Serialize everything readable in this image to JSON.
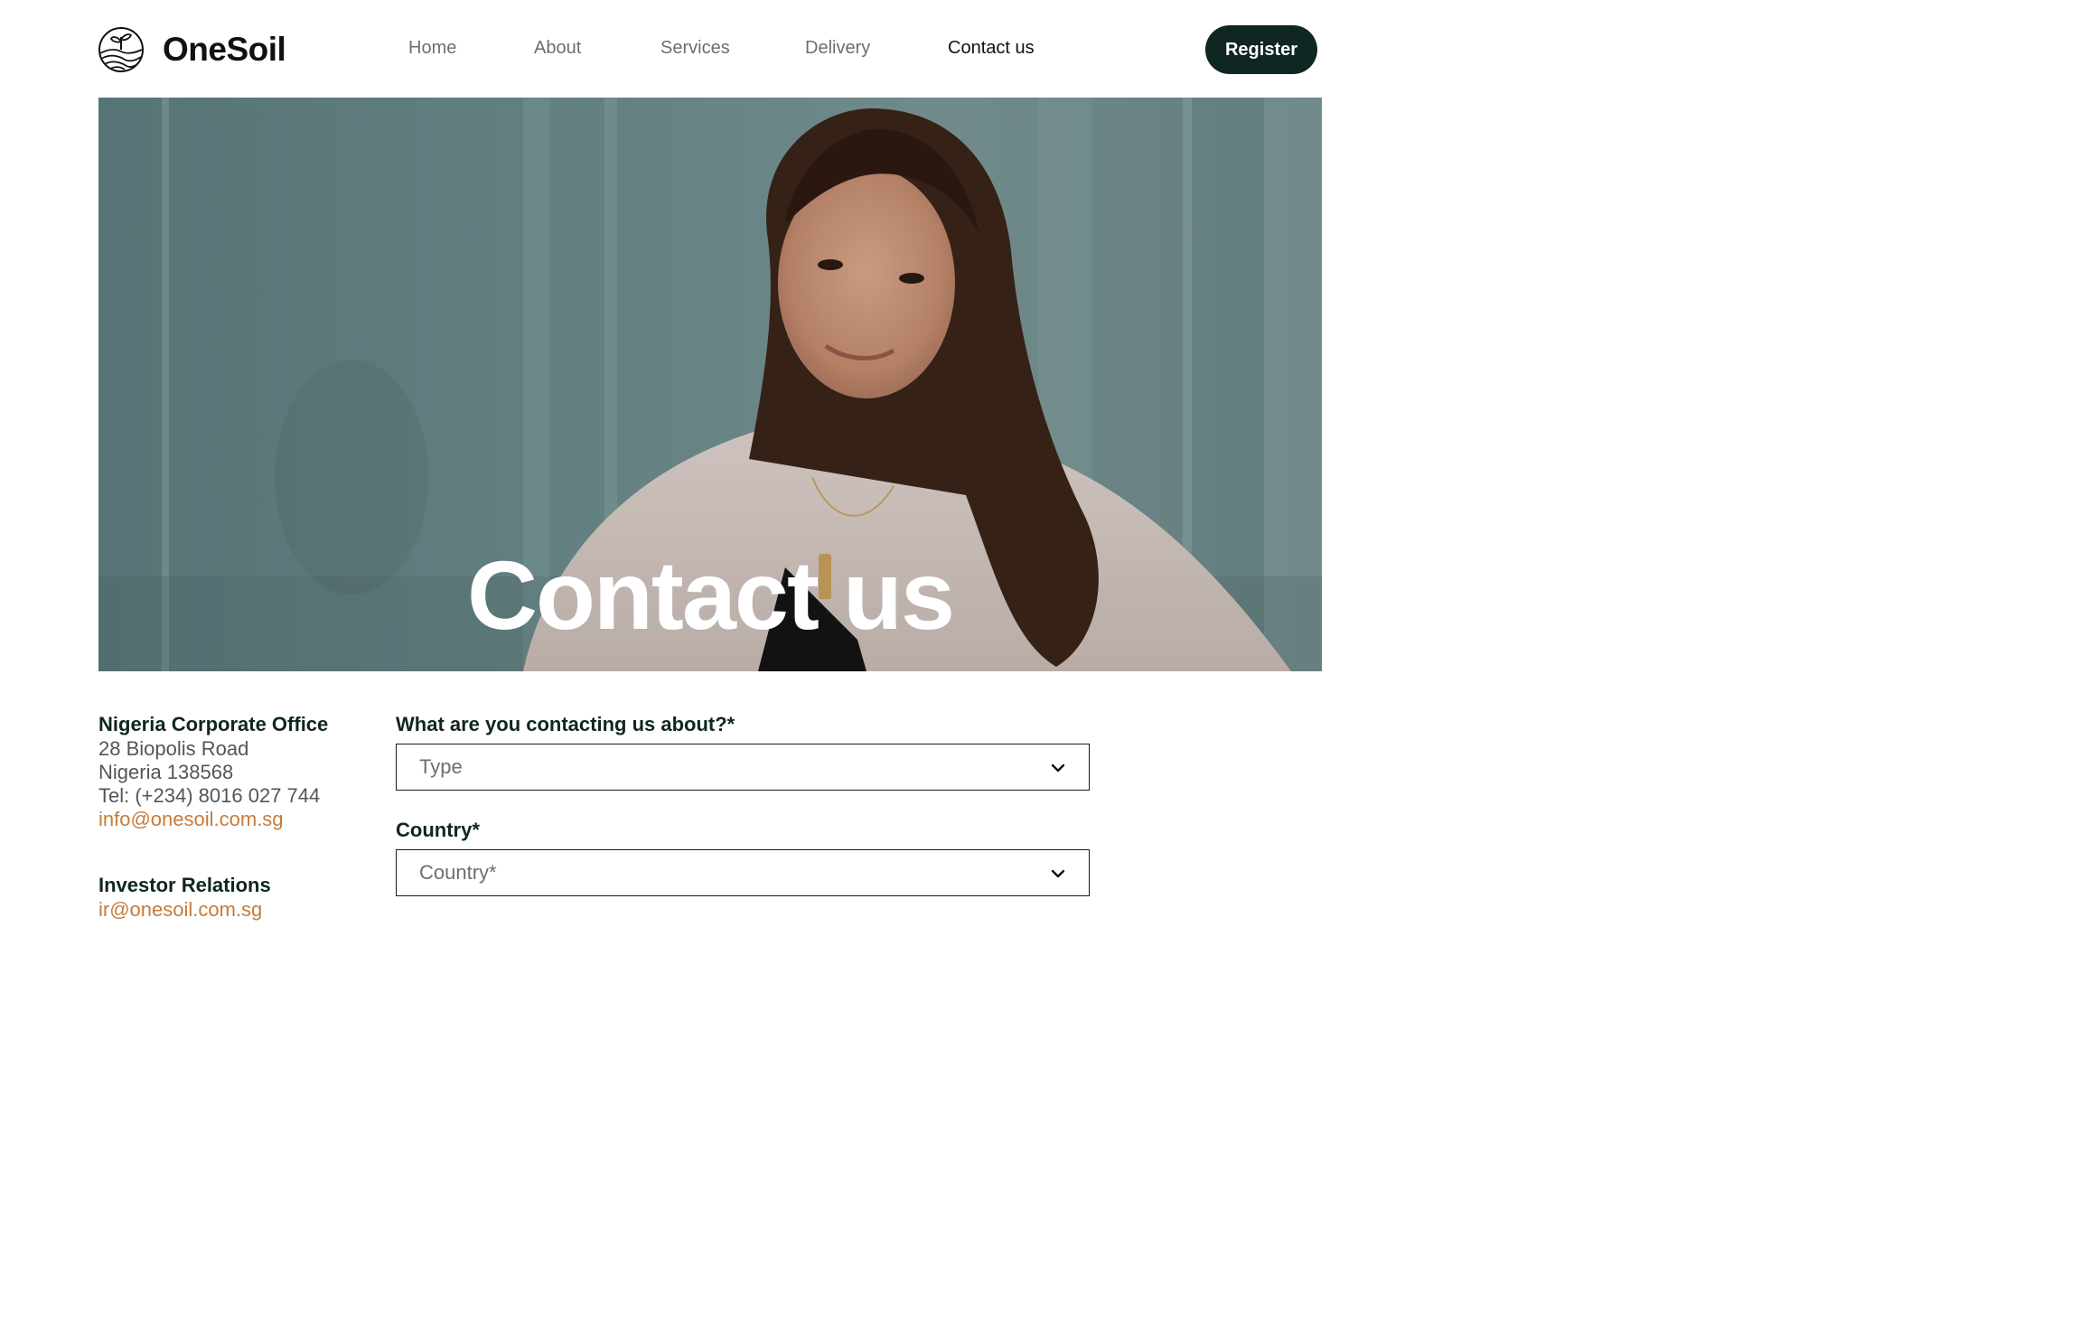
{
  "brand": {
    "name": "OneSoil",
    "logo_icon": "sprout-over-fields-icon"
  },
  "nav": {
    "items": [
      {
        "label": "Home",
        "active": false
      },
      {
        "label": "About",
        "active": false
      },
      {
        "label": "Services",
        "active": false
      },
      {
        "label": "Delivery",
        "active": false
      },
      {
        "label": "Contact us",
        "active": true
      }
    ],
    "register_label": "Register"
  },
  "hero": {
    "title": "Contact us"
  },
  "office": {
    "title": "Nigeria Corporate Office",
    "address_line1": "28 Biopolis Road",
    "address_line2": "Nigeria 138568",
    "phone": "Tel: (+234) 8016 027 744",
    "email": "info@onesoil.com.sg"
  },
  "investor": {
    "title": "Investor Relations",
    "email": "ir@onesoil.com.sg"
  },
  "form": {
    "topic_label": "What are you contacting us about?*",
    "topic_placeholder": "Type",
    "country_label": "Country*",
    "country_placeholder": "Country*"
  },
  "colors": {
    "primary_dark": "#0f2623",
    "accent_link": "#c57c3b",
    "nav_inactive": "#6e6e6e",
    "nav_active": "#111111"
  }
}
